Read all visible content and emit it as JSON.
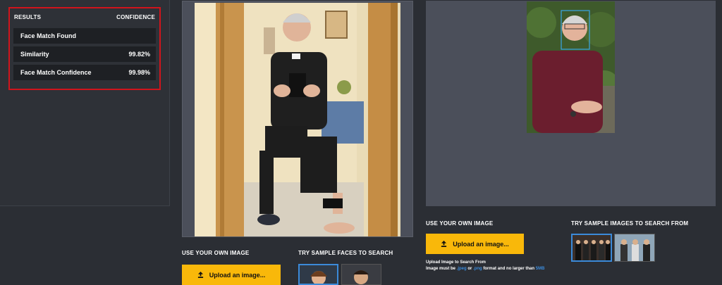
{
  "results": {
    "header_left": "RESULTS",
    "header_right": "CONFIDENCE",
    "rows": [
      {
        "label": "Face Match Found",
        "value": ""
      },
      {
        "label": "Similarity",
        "value": "99.82%"
      },
      {
        "label": "Face Match Confidence",
        "value": "99.98%"
      }
    ]
  },
  "source": {
    "use_own_label": "USE YOUR OWN IMAGE",
    "upload_label": "Upload an image...",
    "samples_label": "TRY SAMPLE FACES TO SEARCH"
  },
  "target": {
    "use_own_label": "USE YOUR OWN IMAGE",
    "upload_label": "Upload an image...",
    "note_line1": "Upload Image to Search From",
    "note_prefix": "Image must be ",
    "note_jpg": ".jpeg",
    "note_or": " or ",
    "note_png": ".png",
    "note_mid": " format and no larger than ",
    "note_size": "5MB",
    "samples_label": "TRY SAMPLE IMAGES TO SEARCH FROM"
  },
  "icons": {
    "upload": "upload-icon"
  },
  "colors": {
    "accent": "#f9b80a",
    "highlight_border": "#d0141c",
    "link": "#3b8ad9",
    "panel": "#4b4f5a"
  }
}
